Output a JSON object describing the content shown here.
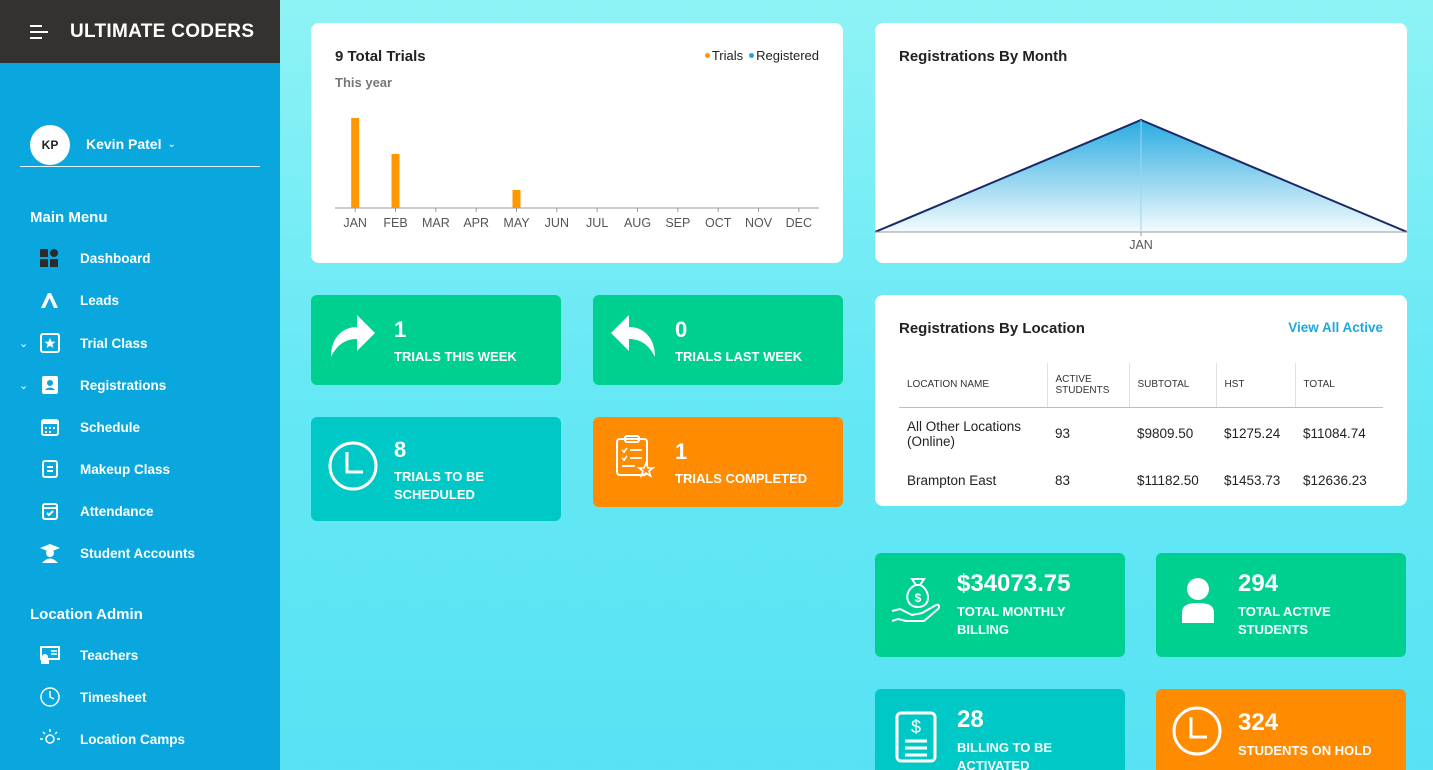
{
  "app": {
    "title": "ULTIMATE CODERS"
  },
  "user": {
    "initials": "KP",
    "name": "Kevin Patel"
  },
  "sidebar": {
    "main_menu_title": "Main Menu",
    "items": [
      {
        "label": "Dashboard",
        "icon": "dashboard-icon"
      },
      {
        "label": "Leads",
        "icon": "leads-icon"
      },
      {
        "label": "Trial Class",
        "icon": "star-badge-icon",
        "expandable": true
      },
      {
        "label": "Registrations",
        "icon": "id-card-icon",
        "expandable": true
      },
      {
        "label": "Schedule",
        "icon": "calendar-icon"
      },
      {
        "label": "Makeup Class",
        "icon": "document-icon"
      },
      {
        "label": "Attendance",
        "icon": "calendar-check-icon"
      },
      {
        "label": "Student Accounts",
        "icon": "graduate-icon"
      }
    ],
    "admin_title": "Location Admin",
    "admin_items": [
      {
        "label": "Teachers",
        "icon": "teacher-icon"
      },
      {
        "label": "Timesheet",
        "icon": "clock-icon"
      },
      {
        "label": "Location Camps",
        "icon": "sun-icon"
      }
    ]
  },
  "trials_card": {
    "title": "9 Total Trials",
    "subtitle": "This year",
    "legend": [
      {
        "name": "Trials",
        "color": "#ff9800"
      },
      {
        "name": "Registered",
        "color": "#1ea7df"
      }
    ]
  },
  "month_card": {
    "title": "Registrations By Month"
  },
  "location_card": {
    "title": "Registrations By Location",
    "link": "View All Active",
    "headers": [
      "LOCATION NAME",
      "ACTIVE STUDENTS",
      "SUBTOTAL",
      "HST",
      "TOTAL"
    ],
    "rows": [
      [
        "All Other Locations (Online)",
        "93",
        "$9809.50",
        "$1275.24",
        "$11084.74"
      ],
      [
        "Brampton East",
        "83",
        "$11182.50",
        "$1453.73",
        "$12636.23"
      ]
    ]
  },
  "stats": {
    "trials_this_week": {
      "value": "1",
      "label": "TRIALS THIS WEEK"
    },
    "trials_last_week": {
      "value": "0",
      "label": "TRIALS LAST WEEK"
    },
    "trials_to_schedule": {
      "value": "8",
      "label_1": "TRIALS TO BE",
      "label_2": "SCHEDULED"
    },
    "trials_completed": {
      "value": "1",
      "label": "TRIALS COMPLETED"
    },
    "monthly_billing": {
      "value": "$34073.75",
      "label_1": "TOTAL MONTHLY",
      "label_2": "BILLING"
    },
    "active_students": {
      "value": "294",
      "label_1": "TOTAL ACTIVE",
      "label_2": "STUDENTS"
    },
    "billing_to_activate": {
      "value": "28",
      "label_1": "BILLING TO BE",
      "label_2": "ACTIVATED"
    },
    "students_on_hold": {
      "value": "324",
      "label": "STUDENTS ON HOLD"
    }
  },
  "colors": {
    "green": "#00d08f",
    "teal": "#00c8c6",
    "orange": "#ff8b00",
    "sidebar": "#0aa7de",
    "header": "#333231"
  },
  "chart_data": [
    {
      "type": "bar",
      "categories": [
        "JAN",
        "FEB",
        "MAR",
        "APR",
        "MAY",
        "JUN",
        "JUL",
        "AUG",
        "SEP",
        "OCT",
        "NOV",
        "DEC"
      ],
      "series": [
        {
          "name": "Trials",
          "values": [
            5,
            3,
            0,
            0,
            1,
            0,
            0,
            0,
            0,
            0,
            0,
            0
          ]
        },
        {
          "name": "Registered",
          "values": [
            0,
            0,
            0,
            0,
            0,
            0,
            0,
            0,
            0,
            0,
            0,
            0
          ]
        }
      ],
      "ylim": [
        0,
        6
      ],
      "grid": false,
      "legend": "top-right"
    },
    {
      "type": "area",
      "categories": [
        "JAN"
      ],
      "values": [
        1
      ],
      "title": "Registrations By Month",
      "ylim": [
        0,
        1.1
      ]
    }
  ]
}
